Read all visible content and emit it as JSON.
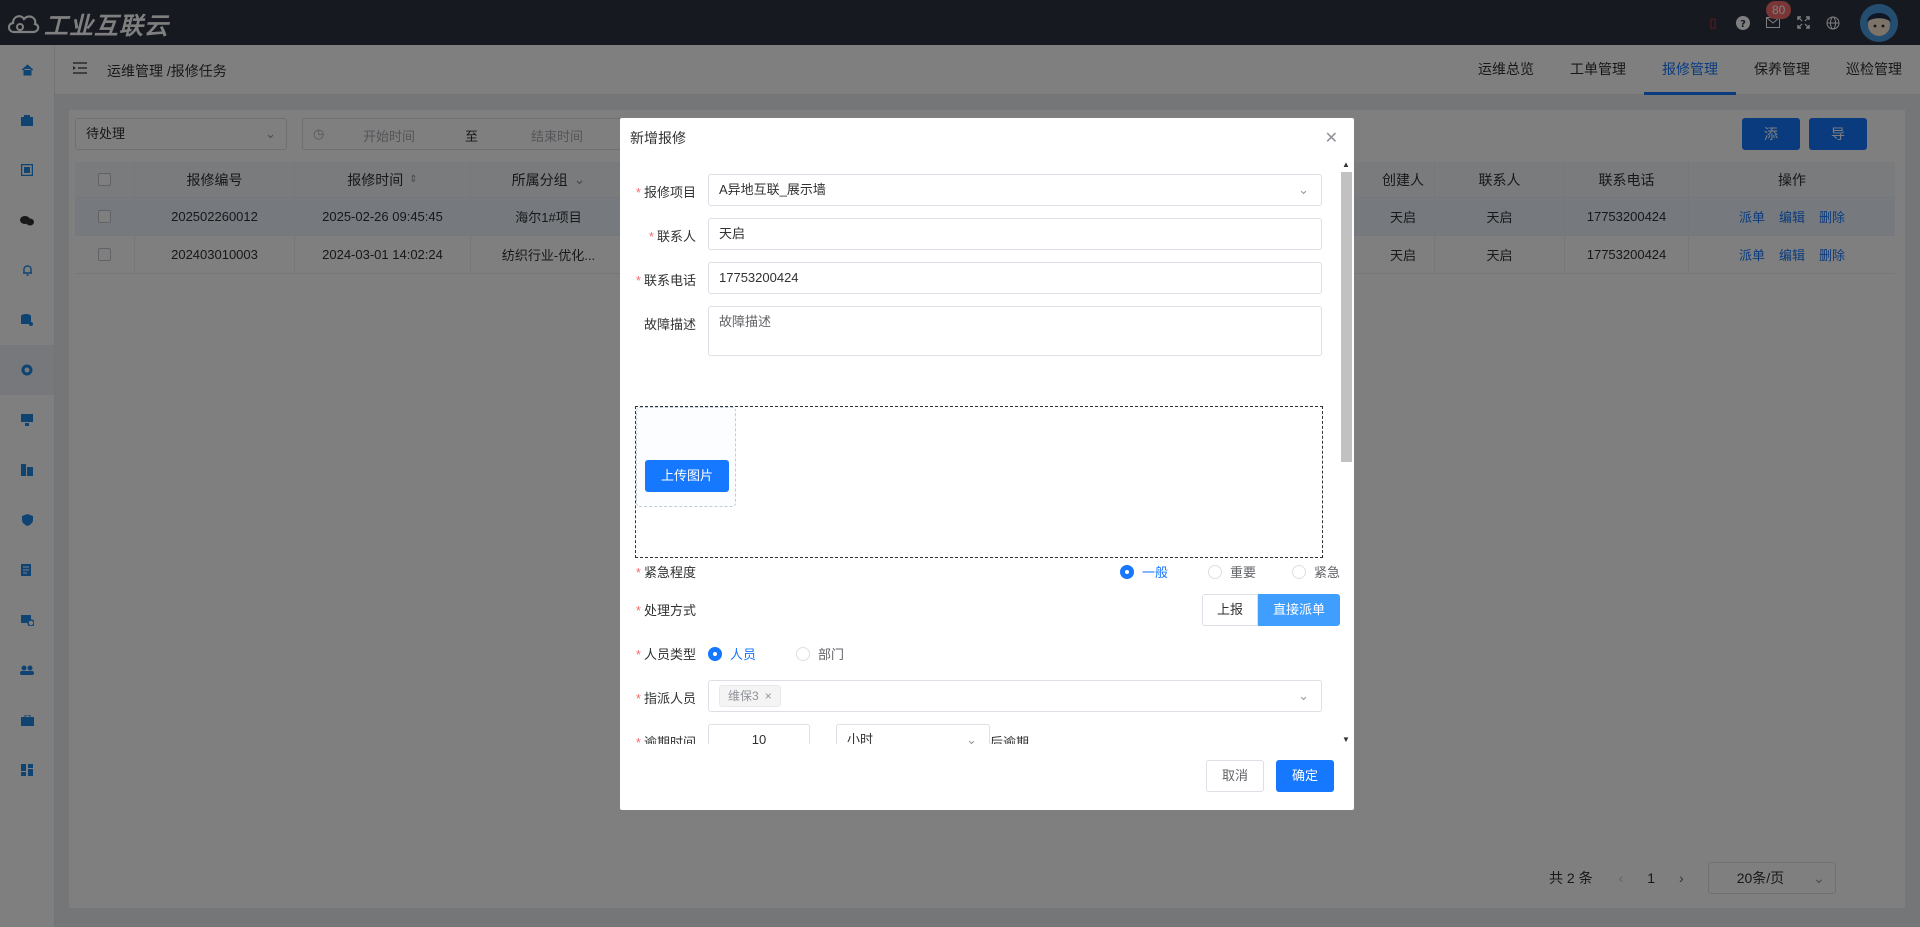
{
  "header": {
    "logo_text": "工业互联云",
    "badge_count": "80"
  },
  "topbar": {
    "breadcrumb": "运维管理 /报修任务",
    "tabs": [
      {
        "label": "运维总览"
      },
      {
        "label": "工单管理"
      },
      {
        "label": "报修管理"
      },
      {
        "label": "保养管理"
      },
      {
        "label": "巡检管理"
      }
    ]
  },
  "filters": {
    "status": "待处理",
    "start_placeholder": "开始时间",
    "date_sep": "至",
    "end_placeholder": "结束时间",
    "add_label": "添加",
    "export_label": "导出"
  },
  "table": {
    "columns": [
      "报修编号",
      "报修时间",
      "所属分组",
      "创建人",
      "联系人",
      "联系电话",
      "操作"
    ],
    "rows": [
      {
        "code": "202502260012",
        "time": "2025-02-26 09:45:45",
        "group": "海尔1#项目",
        "creator": "天启",
        "contact": "天启",
        "phone": "17753200424"
      },
      {
        "code": "202403010003",
        "time": "2024-03-01 14:02:24",
        "group": "纺织行业-优化...",
        "creator": "天启",
        "contact": "天启",
        "phone": "17753200424"
      }
    ],
    "ops": {
      "dispatch": "派单",
      "edit": "编辑",
      "delete": "删除"
    }
  },
  "pager": {
    "total": "共 2 条",
    "page": "1",
    "size": "20条/页"
  },
  "dialog": {
    "title": "新增报修",
    "project_label": "报修项目",
    "project_value": "A异地互联_展示墙",
    "contact_label": "联系人",
    "contact_value": "天启",
    "phone_label": "联系电话",
    "phone_value": "17753200424",
    "desc_label": "故障描述",
    "desc_placeholder": "故障描述",
    "upload_label": "上传图片",
    "urgency_label": "紧急程度",
    "urgency_options": [
      "一般",
      "重要",
      "紧急"
    ],
    "handle_label": "处理方式",
    "handle_options": [
      "上报",
      "直接派单"
    ],
    "person_type_label": "人员类型",
    "person_type_options": [
      "人员",
      "部门"
    ],
    "assign_label": "指派人员",
    "assign_tag": "维保3",
    "overdue_label": "逾期时间",
    "overdue_value": "10",
    "overdue_unit": "小时",
    "overdue_suffix": "后逾期",
    "cancel_label": "取消",
    "ok_label": "确定"
  }
}
